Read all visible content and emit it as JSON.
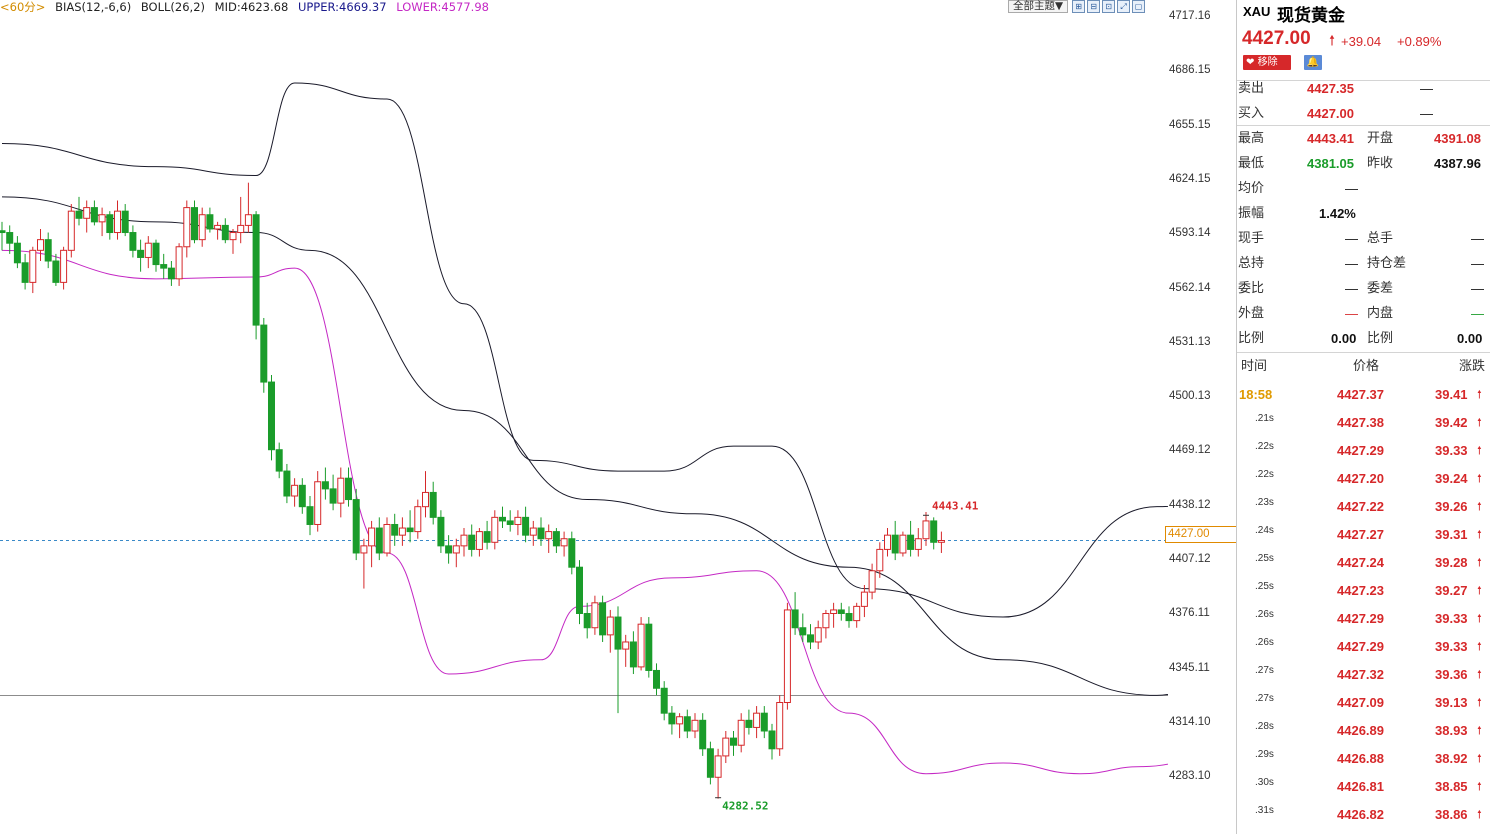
{
  "indicator_bar": {
    "period": "<60分>",
    "bias": "BIAS(12,-6,6)",
    "boll": "BOLL(26,2)",
    "mid": "MID:4623.68",
    "upper": "UPPER:4669.37",
    "lower": "LOWER:4577.98"
  },
  "toolbar": {
    "theme_label": "全部主题▼"
  },
  "axis": {
    "labels": [
      "4717.16",
      "4686.15",
      "4655.15",
      "4624.15",
      "4593.14",
      "4562.14",
      "4531.13",
      "4500.13",
      "4469.12",
      "4438.12",
      "4407.12",
      "4376.11",
      "4345.11",
      "4314.10",
      "4283.10"
    ],
    "current_price": "4427.00",
    "high_marker": "4443.41",
    "low_marker": "4282.52"
  },
  "colors": {
    "up": "#d6282a",
    "down": "#1a9c2a",
    "upper_band": "#1a1a2a",
    "lower_band": "#c428c4",
    "current": "#e08a00"
  },
  "quote": {
    "code": "XAU",
    "name": "现货黄金",
    "last": "4427.00",
    "change": "+39.04",
    "change_pct": "+0.89%",
    "remove_label": "移除",
    "sell_label": "卖出",
    "sell": "4427.35",
    "sell_vol": "—",
    "buy_label": "买入",
    "buy": "4427.00",
    "buy_vol": "—",
    "high_label": "最高",
    "high": "4443.41",
    "open_label": "开盘",
    "open": "4391.08",
    "low_label": "最低",
    "low": "4381.05",
    "prev_label": "昨收",
    "prev": "4387.96",
    "avg_label": "均价",
    "avg": "—",
    "amp_label": "振幅",
    "amp": "1.42%",
    "cur_hand_label": "现手",
    "cur_hand": "—",
    "tot_hand_label": "总手",
    "tot_hand": "—",
    "tot_hold_label": "总持",
    "tot_hold": "—",
    "hold_diff_label": "持仓差",
    "hold_diff": "—",
    "wb_label": "委比",
    "wb": "—",
    "wc_label": "委差",
    "wc": "—",
    "outer_label": "外盘",
    "outer": "—",
    "inner_label": "内盘",
    "inner": "—",
    "ratio_label": "比例",
    "ratio": "0.00",
    "ratio2_label": "比例",
    "ratio2": "0.00"
  },
  "ticks": {
    "head": {
      "time": "时间",
      "price": "价格",
      "change": "涨跌"
    },
    "rows": [
      {
        "t": "18:58",
        "p": "4427.37",
        "c": "39.41"
      },
      {
        "t": ".21s",
        "p": "4427.38",
        "c": "39.42"
      },
      {
        "t": ".22s",
        "p": "4427.29",
        "c": "39.33"
      },
      {
        "t": ".22s",
        "p": "4427.20",
        "c": "39.24"
      },
      {
        "t": ".23s",
        "p": "4427.22",
        "c": "39.26"
      },
      {
        "t": ".24s",
        "p": "4427.27",
        "c": "39.31"
      },
      {
        "t": ".25s",
        "p": "4427.24",
        "c": "39.28"
      },
      {
        "t": ".25s",
        "p": "4427.23",
        "c": "39.27"
      },
      {
        "t": ".26s",
        "p": "4427.29",
        "c": "39.33"
      },
      {
        "t": ".26s",
        "p": "4427.29",
        "c": "39.33"
      },
      {
        "t": ".27s",
        "p": "4427.32",
        "c": "39.36"
      },
      {
        "t": ".27s",
        "p": "4427.09",
        "c": "39.13"
      },
      {
        "t": ".28s",
        "p": "4426.89",
        "c": "38.93"
      },
      {
        "t": ".29s",
        "p": "4426.88",
        "c": "38.92"
      },
      {
        "t": ".30s",
        "p": "4426.81",
        "c": "38.85"
      },
      {
        "t": ".31s",
        "p": "4426.82",
        "c": "38.86"
      }
    ]
  },
  "chart_data": {
    "type": "candlestick",
    "ylim": [
      4270,
      4725
    ],
    "x_count": 123,
    "ohlc": [
      [
        4601,
        4606,
        4590,
        4600
      ],
      [
        4600,
        4604,
        4588,
        4594
      ],
      [
        4594,
        4598,
        4580,
        4583
      ],
      [
        4583,
        4588,
        4568,
        4572
      ],
      [
        4572,
        4592,
        4566,
        4590
      ],
      [
        4590,
        4602,
        4584,
        4596
      ],
      [
        4596,
        4600,
        4580,
        4584
      ],
      [
        4584,
        4588,
        4570,
        4572
      ],
      [
        4572,
        4592,
        4568,
        4590
      ],
      [
        4590,
        4616,
        4586,
        4612
      ],
      [
        4612,
        4620,
        4604,
        4608
      ],
      [
        4608,
        4618,
        4600,
        4614
      ],
      [
        4614,
        4618,
        4604,
        4606
      ],
      [
        4606,
        4614,
        4598,
        4610
      ],
      [
        4610,
        4612,
        4596,
        4600
      ],
      [
        4600,
        4618,
        4596,
        4612
      ],
      [
        4612,
        4616,
        4598,
        4600
      ],
      [
        4600,
        4604,
        4586,
        4590
      ],
      [
        4590,
        4596,
        4578,
        4586
      ],
      [
        4586,
        4598,
        4580,
        4594
      ],
      [
        4594,
        4596,
        4578,
        4582
      ],
      [
        4582,
        4588,
        4574,
        4580
      ],
      [
        4580,
        4584,
        4570,
        4574
      ],
      [
        4574,
        4594,
        4570,
        4592
      ],
      [
        4592,
        4618,
        4586,
        4614
      ],
      [
        4614,
        4618,
        4594,
        4596
      ],
      [
        4596,
        4614,
        4592,
        4610
      ],
      [
        4610,
        4614,
        4600,
        4602
      ],
      [
        4602,
        4606,
        4596,
        4604
      ],
      [
        4604,
        4608,
        4594,
        4596
      ],
      [
        4596,
        4602,
        4588,
        4600
      ],
      [
        4600,
        4620,
        4594,
        4604
      ],
      [
        4604,
        4628,
        4600,
        4610
      ],
      [
        4610,
        4612,
        4540,
        4548
      ],
      [
        4548,
        4552,
        4510,
        4516
      ],
      [
        4516,
        4520,
        4472,
        4478
      ],
      [
        4478,
        4482,
        4462,
        4466
      ],
      [
        4466,
        4470,
        4448,
        4452
      ],
      [
        4452,
        4462,
        4446,
        4458
      ],
      [
        4458,
        4462,
        4442,
        4446
      ],
      [
        4446,
        4452,
        4430,
        4436
      ],
      [
        4436,
        4466,
        4432,
        4460
      ],
      [
        4460,
        4468,
        4450,
        4456
      ],
      [
        4456,
        4464,
        4444,
        4448
      ],
      [
        4448,
        4468,
        4440,
        4462
      ],
      [
        4462,
        4468,
        4446,
        4450
      ],
      [
        4450,
        4456,
        4416,
        4420
      ],
      [
        4420,
        4428,
        4400,
        4424
      ],
      [
        4424,
        4438,
        4412,
        4434
      ],
      [
        4434,
        4440,
        4416,
        4420
      ],
      [
        4420,
        4440,
        4418,
        4436
      ],
      [
        4436,
        4442,
        4424,
        4430
      ],
      [
        4430,
        4440,
        4424,
        4434
      ],
      [
        4434,
        4444,
        4426,
        4432
      ],
      [
        4432,
        4450,
        4428,
        4446
      ],
      [
        4446,
        4466,
        4440,
        4454
      ],
      [
        4454,
        4460,
        4436,
        4440
      ],
      [
        4440,
        4444,
        4420,
        4424
      ],
      [
        4424,
        4430,
        4414,
        4420
      ],
      [
        4420,
        4428,
        4412,
        4424
      ],
      [
        4424,
        4434,
        4418,
        4430
      ],
      [
        4430,
        4436,
        4418,
        4422
      ],
      [
        4422,
        4434,
        4418,
        4432
      ],
      [
        4432,
        4438,
        4422,
        4426
      ],
      [
        4426,
        4444,
        4422,
        4440
      ],
      [
        4440,
        4446,
        4434,
        4438
      ],
      [
        4438,
        4444,
        4432,
        4436
      ],
      [
        4436,
        4444,
        4430,
        4440
      ],
      [
        4440,
        4446,
        4426,
        4430
      ],
      [
        4430,
        4438,
        4424,
        4434
      ],
      [
        4434,
        4440,
        4424,
        4428
      ],
      [
        4428,
        4436,
        4420,
        4432
      ],
      [
        4432,
        4434,
        4420,
        4424
      ],
      [
        4424,
        4432,
        4418,
        4428
      ],
      [
        4428,
        4432,
        4408,
        4412
      ],
      [
        4412,
        4416,
        4380,
        4386
      ],
      [
        4386,
        4392,
        4372,
        4378
      ],
      [
        4378,
        4396,
        4374,
        4392
      ],
      [
        4392,
        4396,
        4370,
        4374
      ],
      [
        4374,
        4388,
        4364,
        4384
      ],
      [
        4384,
        4390,
        4330,
        4366
      ],
      [
        4366,
        4374,
        4356,
        4370
      ],
      [
        4370,
        4376,
        4352,
        4356
      ],
      [
        4356,
        4384,
        4354,
        4380
      ],
      [
        4380,
        4384,
        4350,
        4354
      ],
      [
        4354,
        4358,
        4340,
        4344
      ],
      [
        4344,
        4348,
        4326,
        4330
      ],
      [
        4330,
        4334,
        4318,
        4324
      ],
      [
        4324,
        4330,
        4316,
        4328
      ],
      [
        4328,
        4332,
        4316,
        4320
      ],
      [
        4320,
        4330,
        4316,
        4326
      ],
      [
        4326,
        4330,
        4306,
        4310
      ],
      [
        4310,
        4314,
        4290,
        4294
      ],
      [
        4294,
        4310,
        4282,
        4306
      ],
      [
        4306,
        4320,
        4302,
        4316
      ],
      [
        4316,
        4320,
        4306,
        4312
      ],
      [
        4312,
        4330,
        4308,
        4326
      ],
      [
        4326,
        4332,
        4318,
        4322
      ],
      [
        4322,
        4334,
        4316,
        4330
      ],
      [
        4330,
        4334,
        4316,
        4320
      ],
      [
        4320,
        4324,
        4304,
        4310
      ],
      [
        4310,
        4340,
        4306,
        4336
      ],
      [
        4336,
        4392,
        4332,
        4388
      ],
      [
        4388,
        4398,
        4374,
        4378
      ],
      [
        4378,
        4386,
        4370,
        4374
      ],
      [
        4374,
        4380,
        4366,
        4370
      ],
      [
        4370,
        4382,
        4366,
        4378
      ],
      [
        4378,
        4388,
        4372,
        4386
      ],
      [
        4386,
        4392,
        4378,
        4388
      ],
      [
        4388,
        4392,
        4382,
        4386
      ],
      [
        4386,
        4390,
        4378,
        4382
      ],
      [
        4382,
        4392,
        4378,
        4390
      ],
      [
        4390,
        4402,
        4384,
        4398
      ],
      [
        4398,
        4414,
        4394,
        4410
      ],
      [
        4410,
        4426,
        4406,
        4422
      ],
      [
        4422,
        4434,
        4418,
        4430
      ],
      [
        4430,
        4438,
        4416,
        4420
      ],
      [
        4420,
        4432,
        4418,
        4430
      ],
      [
        4430,
        4438,
        4418,
        4422
      ],
      [
        4422,
        4434,
        4418,
        4428
      ],
      [
        4428,
        4443,
        4424,
        4438
      ],
      [
        4438,
        4440,
        4422,
        4426
      ],
      [
        4426,
        4432,
        4420,
        4427
      ]
    ],
    "boll_upper": [
      [
        0,
        4650
      ],
      [
        20,
        4637
      ],
      [
        33,
        4632
      ],
      [
        38,
        4684
      ],
      [
        50,
        4675
      ],
      [
        60,
        4560
      ],
      [
        69,
        4472
      ],
      [
        80,
        4466
      ],
      [
        86,
        4466
      ],
      [
        95,
        4480
      ],
      [
        100,
        4480
      ],
      [
        112,
        4400
      ],
      [
        130,
        4384
      ],
      [
        150,
        4446
      ],
      [
        168,
        4466
      ]
    ],
    "boll_mid": [
      [
        0,
        4620
      ],
      [
        20,
        4606
      ],
      [
        33,
        4600
      ],
      [
        40,
        4590
      ],
      [
        60,
        4500
      ],
      [
        76,
        4450
      ],
      [
        90,
        4442
      ],
      [
        110,
        4412
      ],
      [
        130,
        4360
      ],
      [
        150,
        4340
      ],
      [
        165,
        4380
      ]
    ],
    "boll_lower": [
      [
        0,
        4590
      ],
      [
        20,
        4574
      ],
      [
        33,
        4575
      ],
      [
        38,
        4580
      ],
      [
        50,
        4420
      ],
      [
        58,
        4352
      ],
      [
        70,
        4360
      ],
      [
        75,
        4390
      ],
      [
        87,
        4406
      ],
      [
        98,
        4410
      ],
      [
        110,
        4330
      ],
      [
        120,
        4296
      ],
      [
        130,
        4302
      ],
      [
        140,
        4296
      ],
      [
        148,
        4300
      ],
      [
        168,
        4330
      ]
    ]
  }
}
